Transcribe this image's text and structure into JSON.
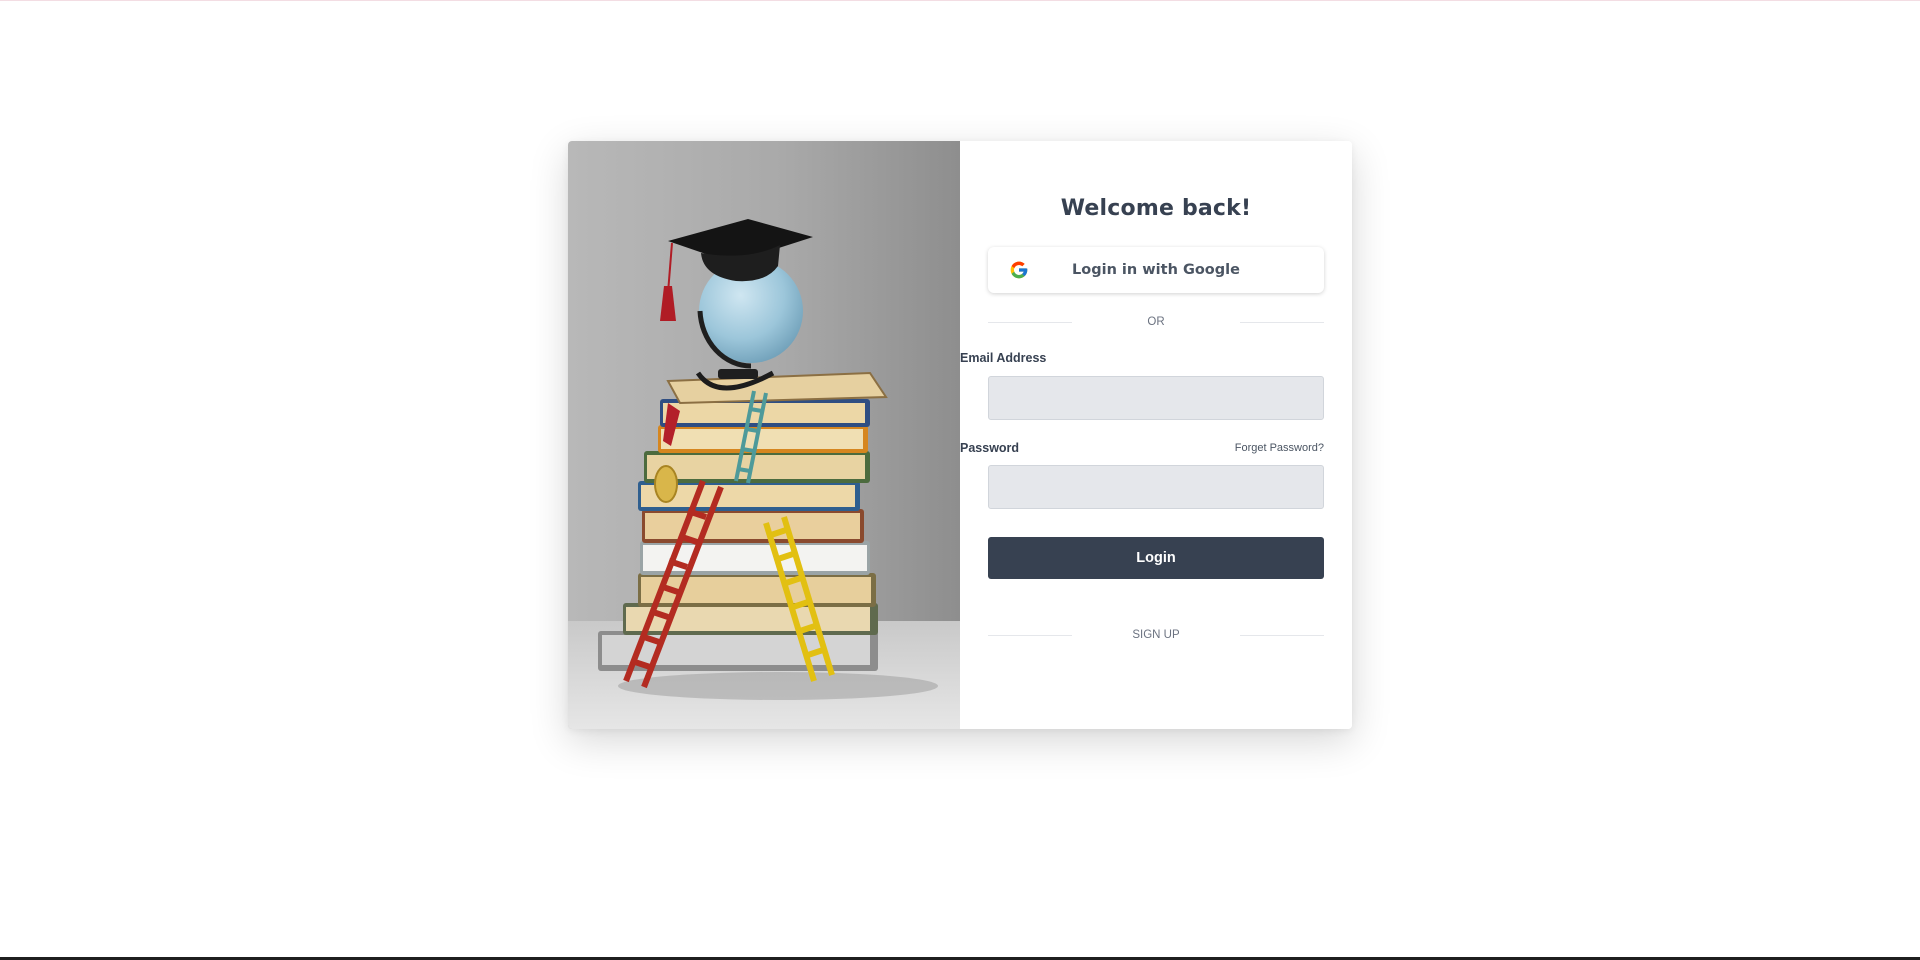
{
  "login": {
    "title": "Welcome back!",
    "google_label": "Login in with Google",
    "or_label": "OR",
    "email_label": "Email Address",
    "email_value": "",
    "password_label": "Password",
    "password_value": "",
    "forgot_label": "Forget Password?",
    "submit_label": "Login",
    "signup_label": "SIGN UP"
  },
  "hero": {
    "image_subject": "graduation cap on globe atop stack of books with ladders"
  },
  "colors": {
    "primary": "#374151",
    "input_bg": "#e5e7eb",
    "text_muted": "#6b7280"
  },
  "icons": {
    "google": "google-icon"
  }
}
